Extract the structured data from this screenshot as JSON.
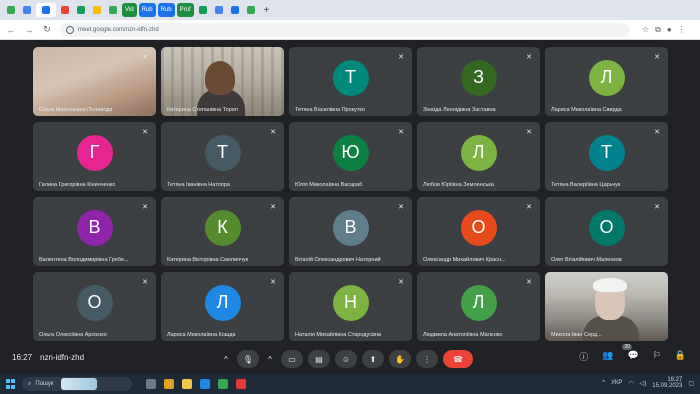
{
  "browser": {
    "tabs": [
      {
        "label": "",
        "color": "#34a853"
      },
      {
        "label": "",
        "color": "#4285f4"
      },
      {
        "label": "",
        "color": "#1a73e8",
        "active": true
      },
      {
        "label": "",
        "color": "#ea4335"
      },
      {
        "label": "",
        "color": "#0f9d58"
      },
      {
        "label": "",
        "color": "#fbbc04"
      },
      {
        "label": "",
        "color": "#34a853"
      },
      {
        "label": "",
        "color": "#0f9d58"
      },
      {
        "label": "",
        "color": "#4285f4"
      },
      {
        "label": "",
        "color": "#1a73e8"
      },
      {
        "label": "",
        "color": "#34a853"
      }
    ],
    "labeled_tabs": [
      {
        "label": "Vid",
        "color": "#1e8e3e"
      },
      {
        "label": "Rub",
        "color": "#1a73e8"
      },
      {
        "label": "Rub",
        "color": "#1a73e8"
      },
      {
        "label": "Prof",
        "color": "#1e8e3e"
      }
    ],
    "address": "meet.google.com/nzn-idfn-zhd"
  },
  "participants": [
    {
      "name": "Ольга Миколаївна Поливода",
      "initial": "",
      "color": "",
      "video": "v1",
      "muted": true
    },
    {
      "name": "Катерина Степанівна Тороп",
      "initial": "",
      "color": "",
      "video": "v1b",
      "muted": false
    },
    {
      "name": "Тетяна Василівна Прокутко",
      "initial": "Т",
      "color": "#00897b",
      "muted": true
    },
    {
      "name": "Зінаїда Леонідівна Заставна",
      "initial": "З",
      "color": "#33691e",
      "muted": true
    },
    {
      "name": "Лариса Миколаївна Свирда",
      "initial": "Л",
      "color": "#7cb342",
      "muted": true
    },
    {
      "name": "Галина Григорівна Кінинченко",
      "initial": "Г",
      "color": "#e52592",
      "muted": true
    },
    {
      "name": "Тетяна Іванівна Натопра",
      "initial": "Т",
      "color": "#455a64",
      "muted": true
    },
    {
      "name": "Юлія Миколаївна Васараб",
      "initial": "Ю",
      "color": "#0b8043",
      "muted": true
    },
    {
      "name": "Любов Юріївна Земленська",
      "initial": "Л",
      "color": "#7cb342",
      "muted": true
    },
    {
      "name": "Тетяна Валеріївна Царьчук",
      "initial": "Т",
      "color": "#00838f",
      "muted": true
    },
    {
      "name": "Валентина Володимирівна Гребе...",
      "initial": "В",
      "color": "#8e24aa",
      "muted": true
    },
    {
      "name": "Катерина Вікторівна Смолинчук",
      "initial": "К",
      "color": "#558b2f",
      "muted": true
    },
    {
      "name": "Віталій Олександрович Наторний",
      "initial": "В",
      "color": "#607d8b",
      "muted": true
    },
    {
      "name": "Олександр Михайлович Красн...",
      "initial": "О",
      "color": "#e64a19",
      "muted": true
    },
    {
      "name": "Олег Віталійович Маленков",
      "initial": "О",
      "color": "#00796b",
      "muted": true
    },
    {
      "name": "Ольга Олексіївна Арсієнко",
      "initial": "О",
      "color": "#455a64",
      "muted": true
    },
    {
      "name": "Лариса Миколаївна Кошда",
      "initial": "Л",
      "color": "#1e88e5",
      "muted": true
    },
    {
      "name": "Наталія Михайлівна Стародусвна",
      "initial": "Н",
      "color": "#7cb342",
      "muted": true
    },
    {
      "name": "Людмила Анатоліївна Малєнко",
      "initial": "Л",
      "color": "#43a047",
      "muted": true
    },
    {
      "name": "Микола Іван Серд...",
      "initial": "",
      "color": "",
      "video": "v2",
      "muted": false
    }
  ],
  "meeting": {
    "time": "16:27",
    "code": "nzn-idfn-zhd",
    "participant_count": "20"
  },
  "taskbar": {
    "search_label": "Пошук",
    "clock_time": "16:27",
    "clock_date": "15.09.2023",
    "lang": "УКР"
  }
}
